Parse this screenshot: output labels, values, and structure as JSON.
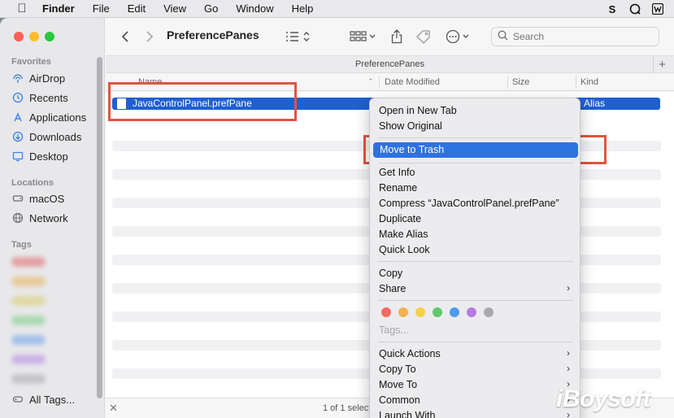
{
  "menubar": {
    "items": [
      "Finder",
      "File",
      "Edit",
      "View",
      "Go",
      "Window",
      "Help"
    ]
  },
  "sidebar": {
    "favorites_title": "Favorites",
    "favorites": [
      {
        "label": "AirDrop",
        "icon": "airdrop-icon"
      },
      {
        "label": "Recents",
        "icon": "clock-icon"
      },
      {
        "label": "Applications",
        "icon": "applications-icon"
      },
      {
        "label": "Downloads",
        "icon": "download-icon"
      },
      {
        "label": "Desktop",
        "icon": "desktop-icon"
      }
    ],
    "locations_title": "Locations",
    "locations": [
      {
        "label": "macOS",
        "icon": "disk-icon"
      },
      {
        "label": "Network",
        "icon": "globe-icon"
      }
    ],
    "tags_title": "Tags",
    "all_tags": "All Tags..."
  },
  "toolbar": {
    "title": "PreferencePanes",
    "search_placeholder": "Search"
  },
  "pathbar": {
    "label": "PreferencePanes"
  },
  "columns": {
    "name": "Name",
    "date_modified": "Date Modified",
    "size": "Size",
    "kind": "Kind"
  },
  "file": {
    "name": "JavaControlPanel.prefPane",
    "kind": "Alias"
  },
  "status": {
    "text": "1 of 1 selected"
  },
  "context_menu": {
    "group1": [
      "Open in New Tab",
      "Show Original"
    ],
    "move_to_trash": "Move to Trash",
    "group2": [
      "Get Info",
      "Rename",
      "Compress “JavaControlPanel.prefPane”",
      "Duplicate",
      "Make Alias",
      "Quick Look"
    ],
    "group3": [
      "Copy",
      "Share"
    ],
    "tag_colors": [
      "#f26a62",
      "#f5b24c",
      "#f4d14a",
      "#5fc96b",
      "#4f9bf0",
      "#b47ce0",
      "#a9a9ad"
    ],
    "tags_label": "Tags...",
    "group4": [
      "Quick Actions",
      "Copy To",
      "Move To",
      "Common",
      "Launch With"
    ]
  },
  "watermark": "iBoysoft",
  "colors": {
    "selection": "#1f5fd1",
    "highlight_box": "#e0553f",
    "menu_selection": "#2e72e0"
  }
}
